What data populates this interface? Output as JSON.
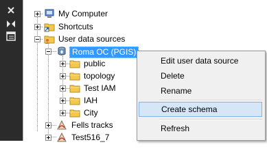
{
  "toolstrip": {
    "buttons": [
      {
        "icon": "close-icon"
      },
      {
        "icon": "auto-hide-icon"
      },
      {
        "icon": "properties-icon"
      }
    ]
  },
  "tree": {
    "my_computer": "My Computer",
    "shortcuts": "Shortcuts",
    "user_data_sources": "User data sources",
    "connection": "Roma OC (PGIS)",
    "schemas": [
      "public",
      "topology",
      "Test IAM",
      "IAH",
      "City"
    ],
    "fells_tracks": "Fells tracks",
    "test516": "Test516_7"
  },
  "context_menu": {
    "edit": "Edit user data source",
    "delete": "Delete",
    "rename": "Rename",
    "create_schema": "Create schema",
    "refresh": "Refresh"
  },
  "colors": {
    "selection": "#3399ff",
    "menu_hover": "#d5e6f7",
    "menu_hover_border": "#7eb4ea",
    "toolstrip": "#2b2b2b"
  }
}
